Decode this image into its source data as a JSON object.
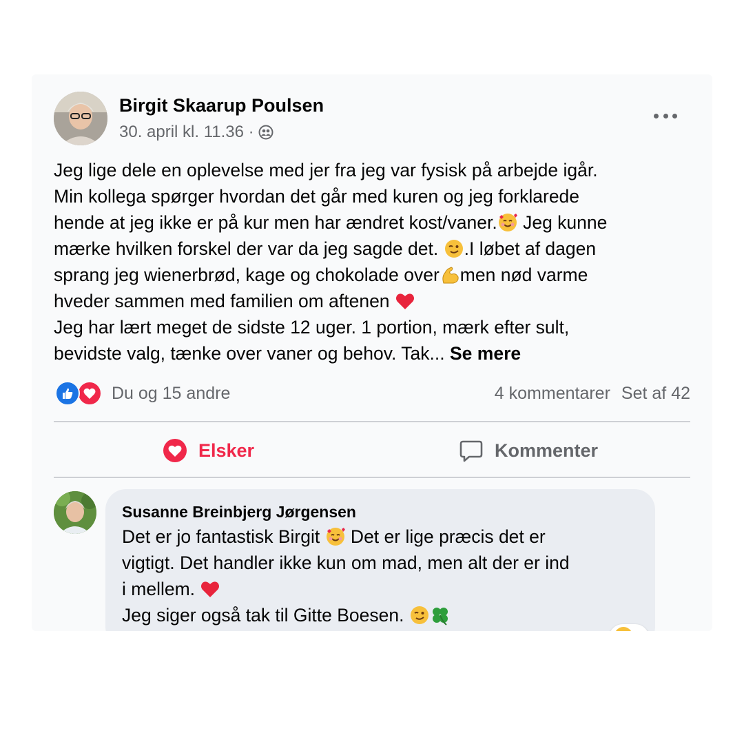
{
  "post": {
    "author": "Birgit Skaarup Poulsen",
    "timestamp": "30. april kl. 11.36 ·",
    "audience_icon": "friends-icon",
    "body_lines": [
      "Jeg lige dele en oplevelse med jer fra jeg var fysisk på arbejde igår.",
      "Min kollega spørger hvordan det går med kuren og jeg forklarede",
      "hende at jeg ikke er på kur men har ændret kost/vaner.",
      " Jeg kunne",
      "mærke hvilken forskel der var da jeg sagde det. ",
      ".I løbet af dagen",
      "sprang jeg wienerbrød, kage og chokolade over",
      "men nød varme",
      "hveder sammen med familien om aftenen ",
      "Jeg har lært meget de sidste 12 uger. 1 portion, mærk efter sult,",
      "bevidste valg, tænke over vaner og behov. Tak... "
    ],
    "see_more": "Se mere",
    "reactions_text": "Du og 15 andre",
    "comments_count": "4 kommentarer",
    "seen_count": "Set af 42"
  },
  "actions": {
    "love_label": "Elsker",
    "comment_label": "Kommenter"
  },
  "comment": {
    "author": "Susanne Breinbjerg Jørgensen",
    "lines": [
      "Det er jo fantastisk Birgit ",
      " Det er lige præcis det er",
      "vigtigt. Det handler ikke kun om mad, men alt der er ind",
      "i mellem. ",
      "Jeg siger også tak til Gitte Boesen. "
    ]
  },
  "colors": {
    "love": "#f0284a",
    "like": "#1b74e4",
    "secondary_text": "#65676b",
    "comment_bubble": "#eaedf2"
  }
}
